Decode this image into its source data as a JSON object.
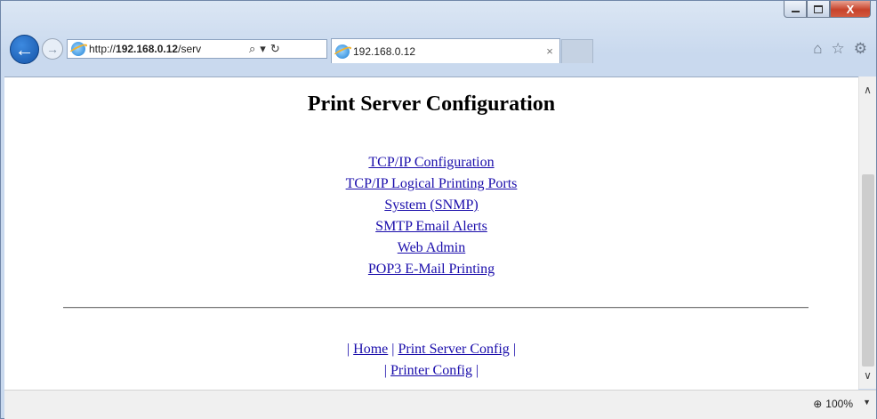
{
  "window": {
    "minimize_glyph": "minimize-icon",
    "maximize_glyph": "maximize-icon",
    "close_label": "X"
  },
  "toolbar": {
    "address_scheme": "http://",
    "address_host": "192.168.0.12",
    "address_path": "/serv",
    "tab_title": "192.168.0.12",
    "tab_close": "×",
    "back_glyph": "←",
    "forward_glyph": "→"
  },
  "page": {
    "title": "Print Server Configuration",
    "links": [
      "TCP/IP Configuration",
      "TCP/IP Logical Printing Ports",
      "System (SNMP)",
      "SMTP Email Alerts",
      "Web Admin",
      "POP3 E-Mail Printing"
    ],
    "footer": {
      "home": "Home",
      "print_server_config": "Print Server Config",
      "printer_config": "Printer Config",
      "separator": "|"
    }
  },
  "statusbar": {
    "zoom": "100%"
  },
  "colors": {
    "link": "#1a0dab",
    "close_button": "#c7432b",
    "back_button": "#1554a8"
  },
  "icons": [
    "back-icon",
    "forward-icon",
    "ie-logo-icon",
    "search-icon",
    "dropdown-icon",
    "refresh-icon",
    "home-icon",
    "favorites-icon",
    "gear-icon",
    "zoom-icon"
  ]
}
